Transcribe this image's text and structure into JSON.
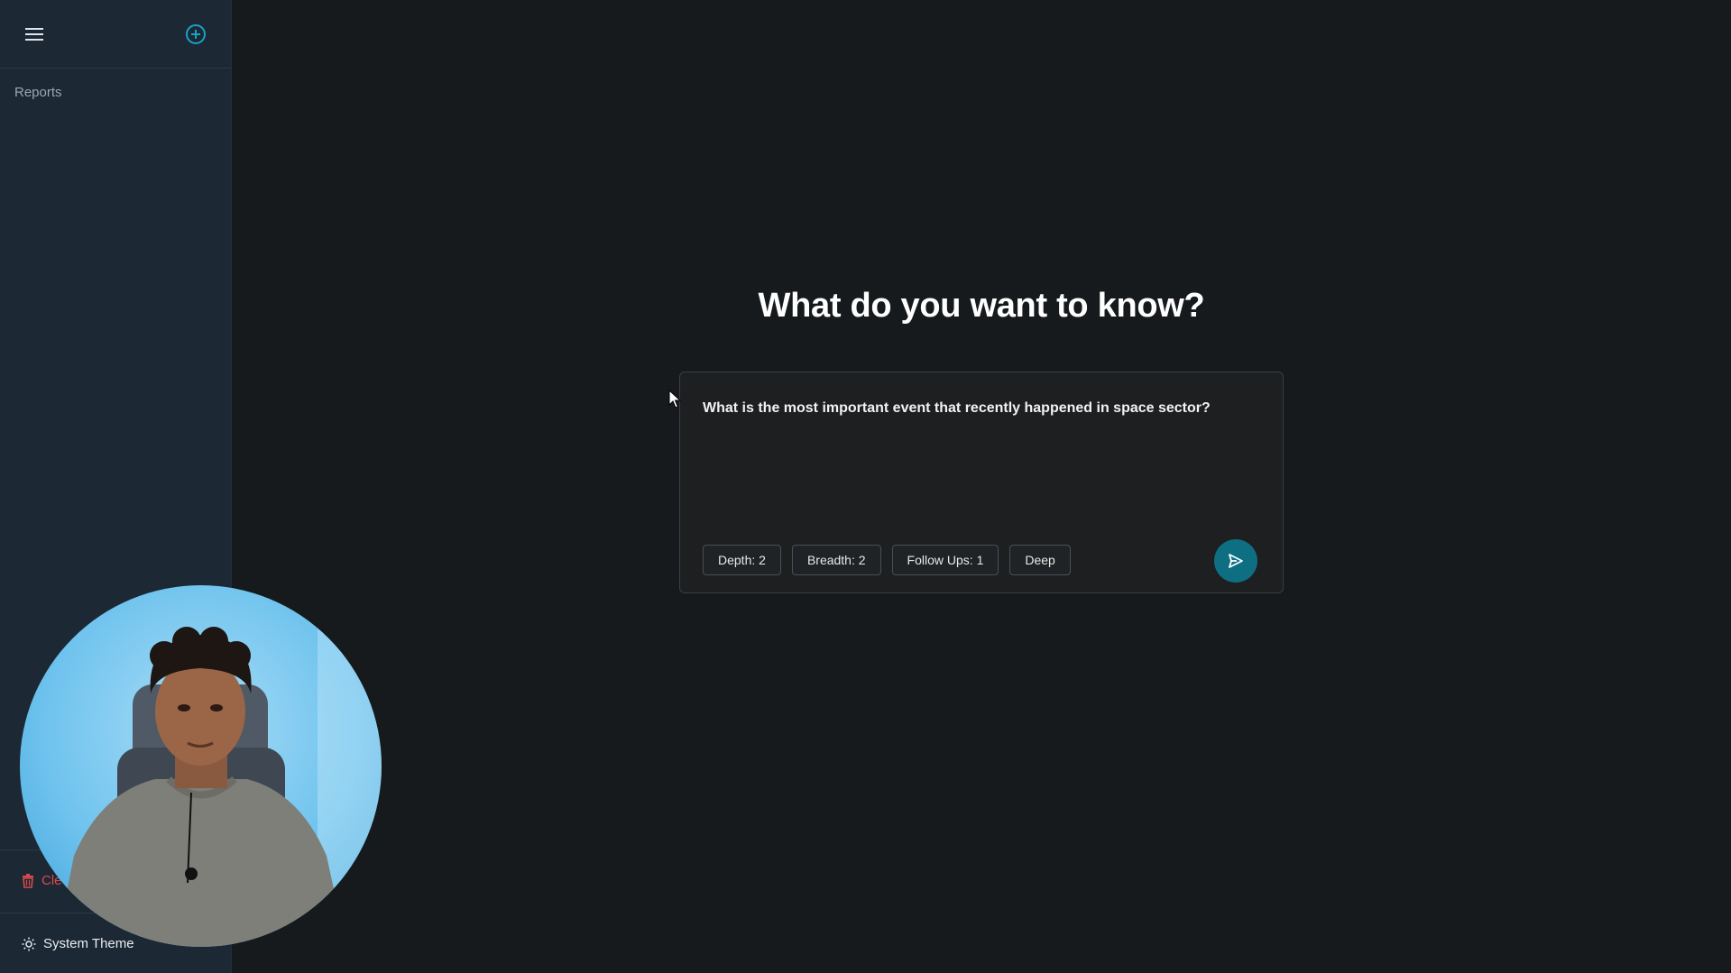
{
  "sidebar": {
    "section_label": "Reports",
    "clear_label": "Cle",
    "theme_label": "System Theme"
  },
  "main": {
    "heading": "What do you want to know?",
    "query": "What is the most important event that recently happened in space sector?",
    "chips": [
      {
        "label": "Depth: 2"
      },
      {
        "label": "Breadth: 2"
      },
      {
        "label": "Follow Ups: 1"
      },
      {
        "label": "Deep"
      }
    ]
  },
  "colors": {
    "background": "#161a1c",
    "sidebar": "#1c2834",
    "accent": "#0e6f83",
    "danger": "#d94b4b"
  },
  "icons": [
    "menu-icon",
    "plus-circle-icon",
    "trash-icon",
    "sun-icon",
    "send-icon",
    "mouse-cursor-icon"
  ]
}
